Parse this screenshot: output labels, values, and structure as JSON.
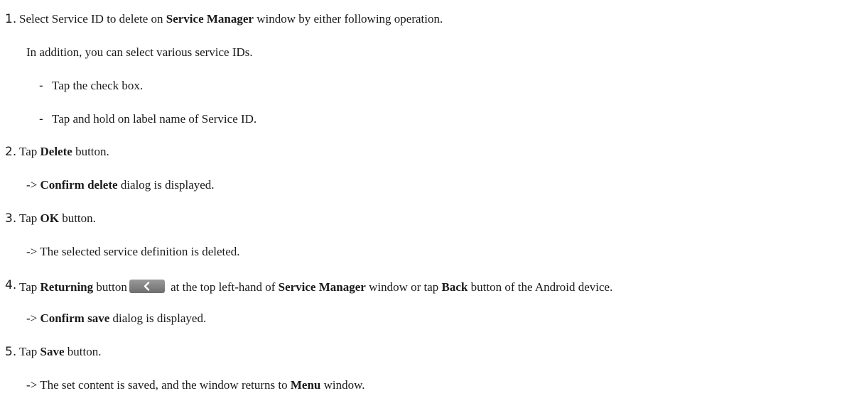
{
  "steps": [
    {
      "number": "1.",
      "text_a": "Select Service ID to delete on ",
      "bold_a": "Service Manager",
      "text_b": " window by either following operation.",
      "note": "In addition, you can select various service IDs.",
      "bullets": [
        {
          "dash": "-",
          "text": "Tap the check box."
        },
        {
          "dash": "-",
          "text": "Tap and hold on label name of Service ID."
        }
      ]
    },
    {
      "number": "2.",
      "text_a": "Tap ",
      "bold_a": "Delete",
      "text_b": " button.",
      "result_prefix": "-> ",
      "result_bold": "Confirm delete",
      "result_text": " dialog is displayed."
    },
    {
      "number": "3.",
      "text_a": "Tap ",
      "bold_a": "OK",
      "text_b": " button.",
      "result_prefix": "-> ",
      "result_text": "The selected service definition is deleted."
    },
    {
      "number": "4.",
      "text_a": "Tap ",
      "bold_a": "Returning",
      "text_b": " button",
      "icon": "back-arrow-icon",
      "text_c": " at the top left-hand of ",
      "bold_b": "Service Manager",
      "text_d": " window or tap ",
      "bold_c": "Back",
      "text_e": " button of the Android device.",
      "result_prefix": "-> ",
      "result_bold": "Confirm save",
      "result_text": " dialog is displayed."
    },
    {
      "number": "5.",
      "text_a": "Tap ",
      "bold_a": "Save",
      "text_b": " button.",
      "result_prefix": "-> ",
      "result_text": "The set content is saved, and the window returns to ",
      "result_bold": "Menu",
      "result_suffix": " window."
    }
  ]
}
